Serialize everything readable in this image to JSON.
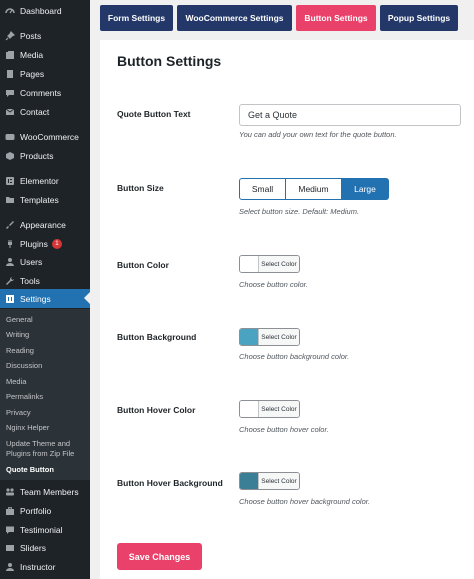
{
  "sidebar": {
    "dashboard": "Dashboard",
    "posts": "Posts",
    "media": "Media",
    "pages": "Pages",
    "comments": "Comments",
    "contact": "Contact",
    "woocommerce": "WooCommerce",
    "products": "Products",
    "elementor": "Elementor",
    "templates": "Templates",
    "appearance": "Appearance",
    "plugins": "Plugins",
    "plugins_badge": "1",
    "users": "Users",
    "tools": "Tools",
    "settings": "Settings",
    "team_members": "Team Members",
    "portfolio": "Portfolio",
    "testimonial": "Testimonial",
    "sliders": "Sliders",
    "instructor": "Instructor"
  },
  "settings_submenu": {
    "general": "General",
    "writing": "Writing",
    "reading": "Reading",
    "discussion": "Discussion",
    "media": "Media",
    "permalinks": "Permalinks",
    "privacy": "Privacy",
    "nginx_helper": "Nginx Helper",
    "update_theme": "Update Theme and Plugins from Zip File",
    "quote_button": "Quote Button"
  },
  "tabs": {
    "form_settings": "Form Settings",
    "woocommerce_settings": "WooCommerce Settings",
    "button_settings": "Button Settings",
    "popup_settings": "Popup Settings"
  },
  "page": {
    "title": "Button Settings",
    "quote_text_label": "Quote Button Text",
    "quote_text_value": "Get a Quote",
    "quote_text_desc": "You can add your own text for the quote button.",
    "size_label": "Button Size",
    "size_small": "Small",
    "size_medium": "Medium",
    "size_large": "Large",
    "size_desc": "Select button size. Default: Medium.",
    "color_label": "Button Color",
    "color_desc": "Choose button color.",
    "bg_label": "Button Background",
    "bg_desc": "Choose button background color.",
    "hover_color_label": "Button Hover Color",
    "hover_color_desc": "Choose button hover color.",
    "hover_bg_label": "Button Hover Background",
    "hover_bg_desc": "Choose button hover background color.",
    "select_color": "Select Color",
    "save_button": "Save Changes"
  },
  "colors": {
    "sidebar_bg": "#1d2327",
    "active_blue": "#2271b1",
    "tab_navy": "#233869",
    "accent_pink": "#e9416a",
    "button_color": "#ffffff",
    "button_background": "#4aa3c0",
    "button_hover_color": "#ffffff",
    "button_hover_background": "#3a7f96"
  }
}
